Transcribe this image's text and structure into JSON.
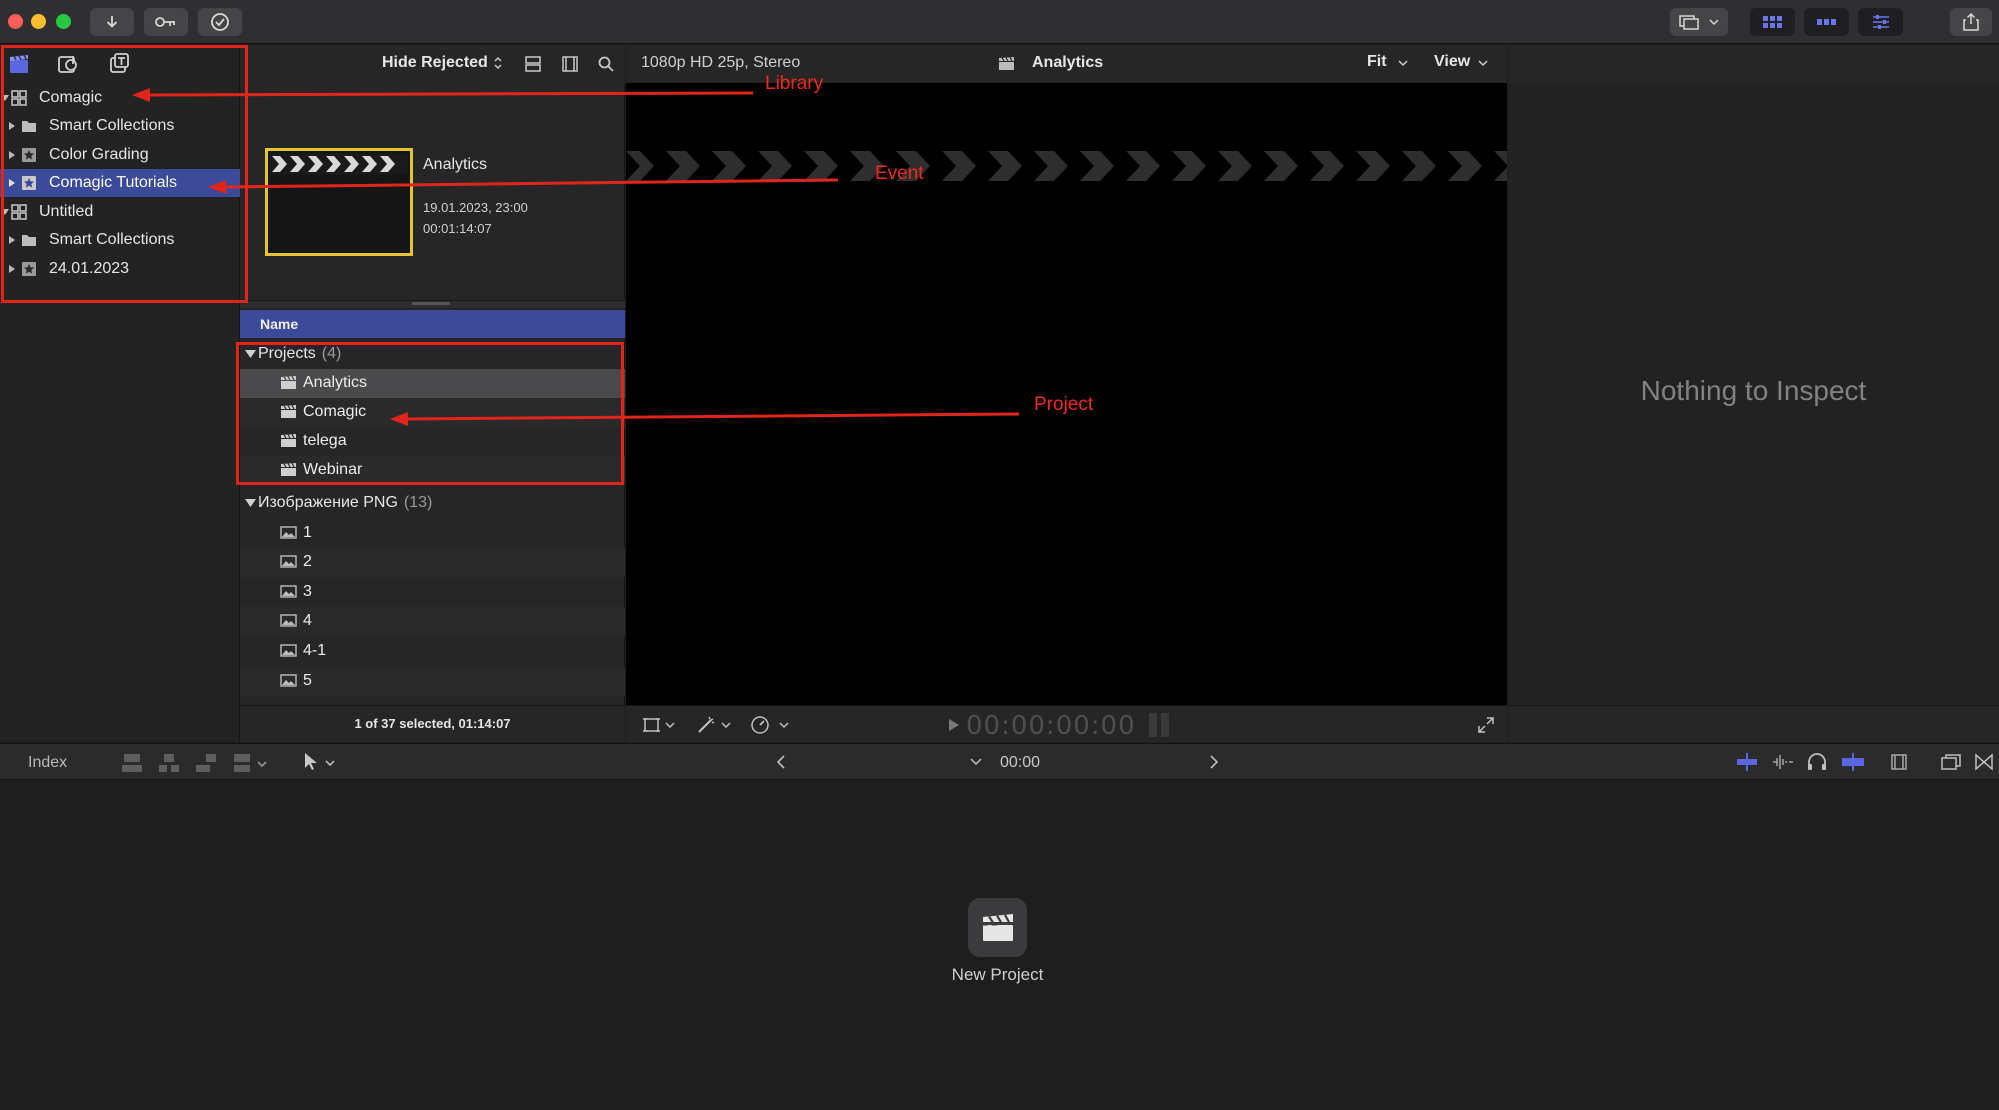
{
  "library_sidebar": {
    "items": [
      {
        "label": "Comagic",
        "type": "library",
        "expanded": true
      },
      {
        "label": "Smart Collections",
        "type": "folder"
      },
      {
        "label": "Color Grading",
        "type": "event"
      },
      {
        "label": "Comagic Tutorials",
        "type": "event",
        "selected": true
      },
      {
        "label": "Untitled",
        "type": "library",
        "expanded": true
      },
      {
        "label": "Smart Collections",
        "type": "folder"
      },
      {
        "label": "24.01.2023",
        "type": "event"
      }
    ]
  },
  "browser": {
    "filter_label": "Hide Rejected",
    "clip": {
      "title": "Analytics",
      "date": "19.01.2023, 23:00",
      "duration": "00:01:14:07"
    },
    "column_header": "Name",
    "groups": [
      {
        "label": "Projects",
        "count": "(4)",
        "items": [
          "Analytics",
          "Comagic",
          "telega",
          "Webinar"
        ]
      },
      {
        "label": "Изображение PNG",
        "count": "(13)",
        "items": [
          "1",
          "2",
          "3",
          "4",
          "4-1",
          "5"
        ]
      }
    ],
    "status": "1 of 37 selected, 01:14:07"
  },
  "viewer": {
    "format": "1080p HD 25p, Stereo",
    "title": "Analytics",
    "fit_label": "Fit",
    "view_label": "View",
    "timecode": "00:00:00:00"
  },
  "inspector": {
    "empty_text": "Nothing to Inspect"
  },
  "timeline": {
    "index_label": "Index",
    "timecode": "00:00",
    "new_project_label": "New Project"
  },
  "annotations": {
    "library": "Library",
    "event": "Event",
    "project": "Project",
    "color": "#e0261b"
  },
  "colors": {
    "selection": "#3b4a99",
    "accent": "#5b67e0",
    "clip_border": "#e3c432"
  }
}
